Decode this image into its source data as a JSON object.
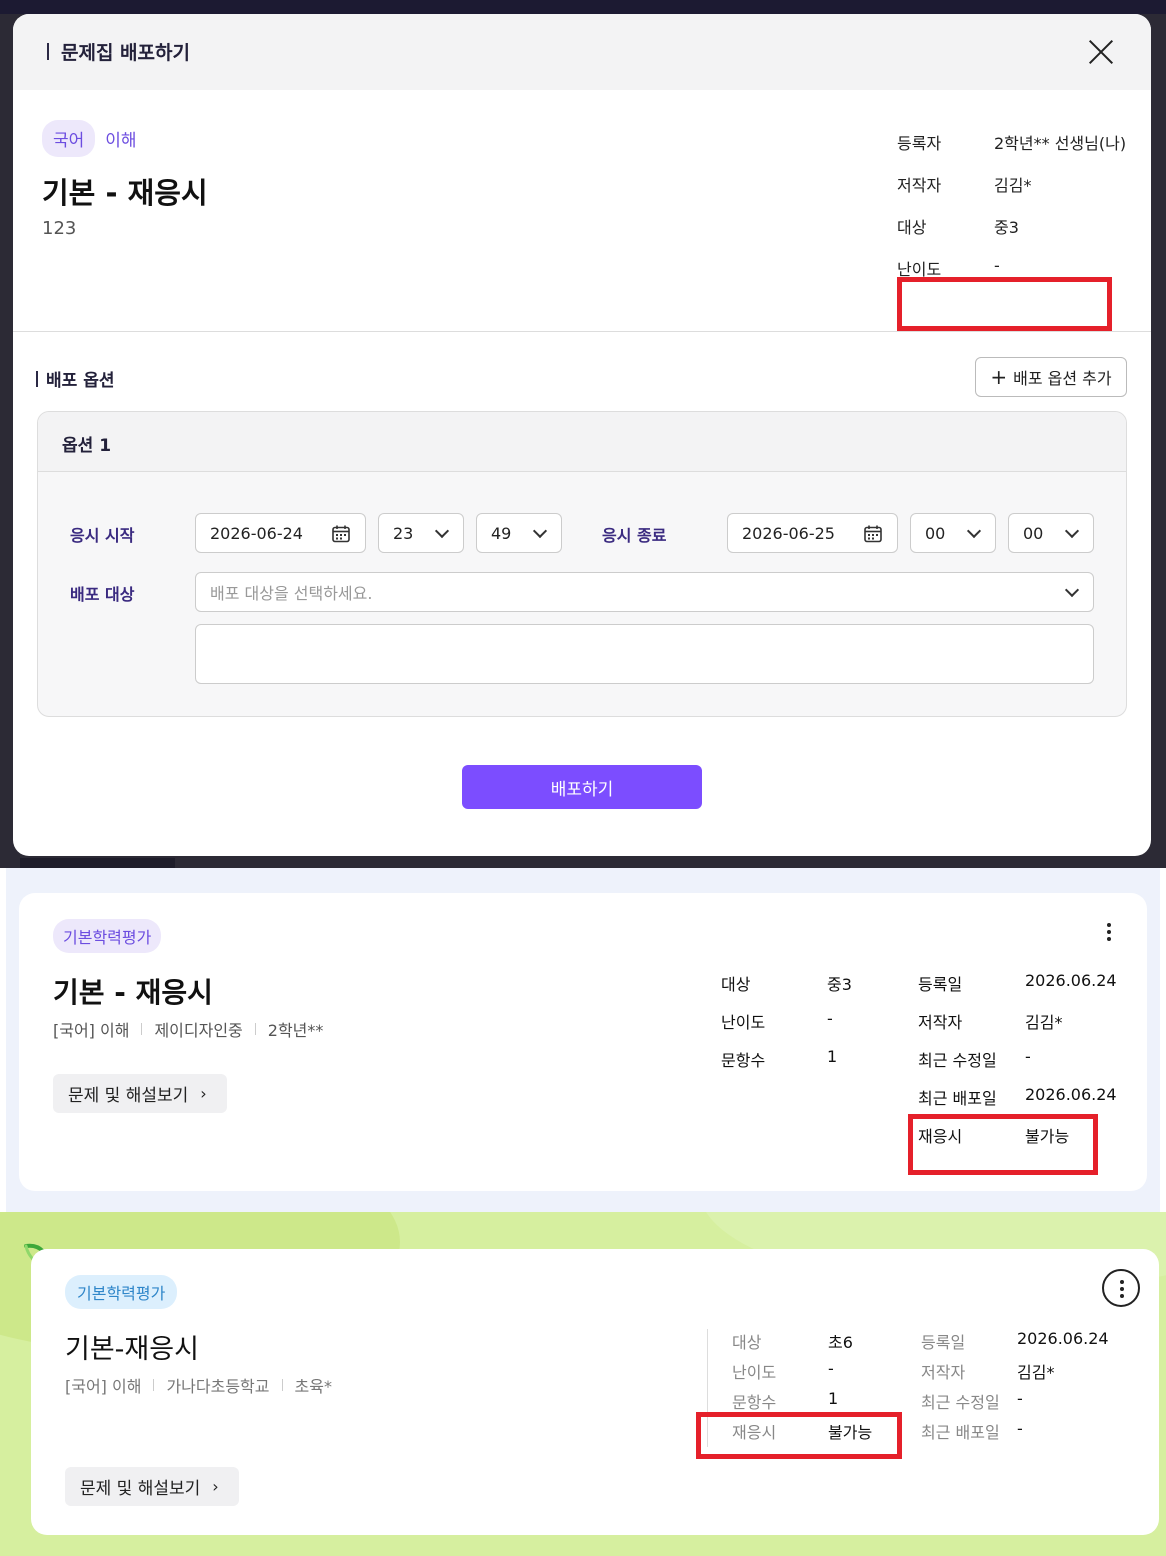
{
  "modal": {
    "title": "문제집 배포하기",
    "subject_chip": "국어",
    "subject_sub": "이해",
    "book_title": "기본 - 재응시",
    "book_desc": "123",
    "meta": [
      {
        "label": "등록자",
        "value": "2학년** 선생님(나)"
      },
      {
        "label": "저작자",
        "value": "김김*"
      },
      {
        "label": "대상",
        "value": "중3"
      },
      {
        "label": "난이도",
        "value": "-"
      }
    ],
    "section_label": "배포 옵션",
    "add_option_label": "배포 옵션 추가",
    "option_title": "옵션 1",
    "start_label": "응시 시작",
    "start_date": "2026-06-24",
    "start_hour": "23",
    "start_min": "49",
    "end_label": "응시 종료",
    "end_date": "2026-06-25",
    "end_hour": "00",
    "end_min": "00",
    "target_label": "배포 대상",
    "target_placeholder": "배포 대상을 선택하세요.",
    "submit_label": "배포하기"
  },
  "card2": {
    "chip": "기본학력평가",
    "title": "기본 - 재응시",
    "sub": [
      "[국어] 이해",
      "제이디자인중",
      "2학년**"
    ],
    "view_label": "문제 및 해설보기",
    "meta_left": [
      {
        "label": "대상",
        "value": "중3"
      },
      {
        "label": "난이도",
        "value": "-"
      },
      {
        "label": "문항수",
        "value": "1"
      }
    ],
    "meta_right": [
      {
        "label": "등록일",
        "value": "2026.06.24"
      },
      {
        "label": "저작자",
        "value": "김김*"
      },
      {
        "label": "최근 수정일",
        "value": "-"
      },
      {
        "label": "최근 배포일",
        "value": "2026.06.24"
      },
      {
        "label": "재응시",
        "value": "불가능"
      }
    ]
  },
  "card3": {
    "chip": "기본학력평가",
    "title": "기본-재응시",
    "sub": [
      "[국어] 이해",
      "가나다초등학교",
      "초육*"
    ],
    "view_label": "문제 및 해설보기",
    "meta_left": [
      {
        "label": "대상",
        "value": "초6"
      },
      {
        "label": "난이도",
        "value": "-"
      },
      {
        "label": "문항수",
        "value": "1"
      },
      {
        "label": "재응시",
        "value": "불가능"
      }
    ],
    "meta_right": [
      {
        "label": "등록일",
        "value": "2026.06.24"
      },
      {
        "label": "저작자",
        "value": "김김*"
      },
      {
        "label": "최근 수정일",
        "value": "-"
      },
      {
        "label": "최근 배포일",
        "value": "-"
      }
    ]
  },
  "icons": {
    "close": "close-icon",
    "calendar": "calendar-icon",
    "chevron": "chevron-down-icon",
    "plus": "plus-icon",
    "more": "more-vertical-icon"
  },
  "colors": {
    "accent": "#7c4dff",
    "highlight": "#e5202a"
  }
}
